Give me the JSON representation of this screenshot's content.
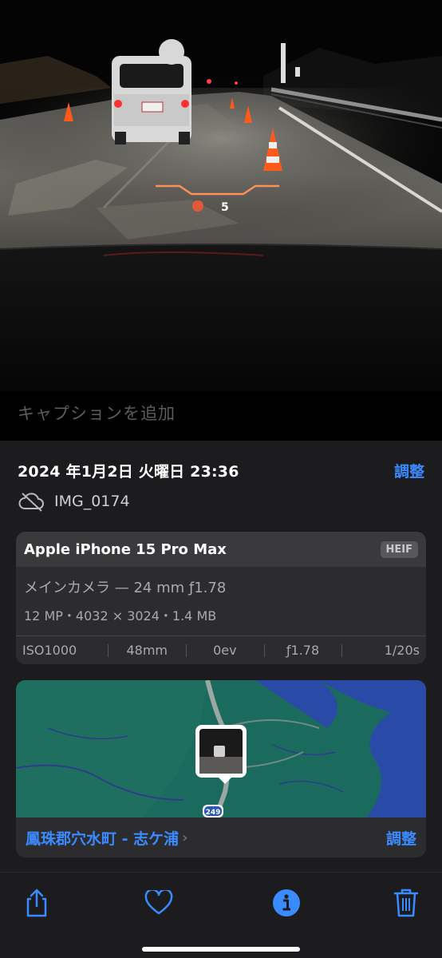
{
  "caption": {
    "placeholder": "キャプションを追加"
  },
  "info": {
    "date": "2024 年1月2日 火曜日 23:36",
    "adjust_label": "調整",
    "filename": "IMG_0174",
    "cloud_icon": "cloud-off-icon"
  },
  "camera": {
    "model": "Apple iPhone 15 Pro Max",
    "format": "HEIF",
    "lens": "メインカメラ — 24 mm ƒ1.78",
    "specs": "12 MP・4032 × 3024・1.4 MB",
    "exif": [
      "ISO1000",
      "48mm",
      "0ev",
      "ƒ1.78",
      "1/20s"
    ]
  },
  "map": {
    "route_label": "249",
    "place": "鳳珠郡穴水町 - 志ケ浦",
    "adjust_label": "調整"
  },
  "hud": {
    "speed": "5"
  },
  "toolbar": {
    "icons": [
      "share-icon",
      "heart-icon",
      "info-icon",
      "trash-icon"
    ],
    "accent": "#3a8bff"
  }
}
